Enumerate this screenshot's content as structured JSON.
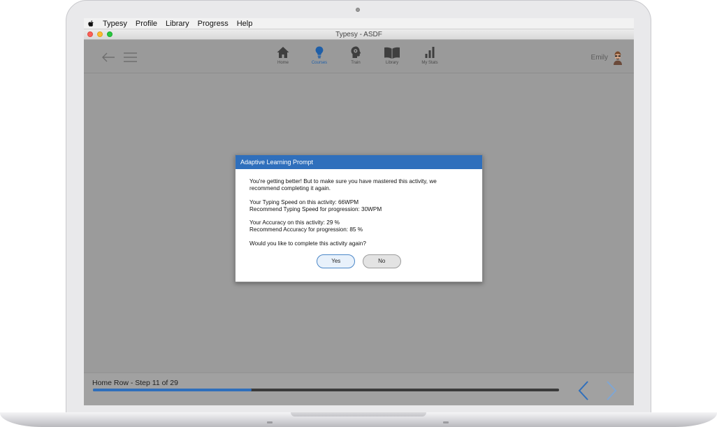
{
  "menubar": {
    "items": [
      "Typesy",
      "Profile",
      "Library",
      "Progress",
      "Help"
    ]
  },
  "window": {
    "title": "Typesy - ASDF"
  },
  "nav": {
    "back_icon": "arrow-left-icon",
    "menu_icon": "hamburger-icon",
    "items": [
      {
        "label": "Home",
        "icon": "home-icon",
        "active": false
      },
      {
        "label": "Courses",
        "icon": "lightbulb-icon",
        "active": true
      },
      {
        "label": "Train",
        "icon": "brain-head-icon",
        "active": false
      },
      {
        "label": "Library",
        "icon": "book-icon",
        "active": false
      },
      {
        "label": "My Stats",
        "icon": "bar-chart-icon",
        "active": false
      }
    ]
  },
  "user": {
    "name": "Emily"
  },
  "dialog": {
    "title": "Adaptive Learning Prompt",
    "intro": "You're getting better! But to make sure you have mastered this activity, we recommend completing it again.",
    "speed_line": "Your Typing Speed on this activity: 66WPM",
    "speed_recommend": "Recommend Typing Speed for progression: 30WPM",
    "accuracy_line": "Your Accuracy on this activity: 29 %",
    "accuracy_recommend": "Recommend Accuracy for progression: 85 %",
    "question": "Would you like to complete this activity again?",
    "yes_label": "Yes",
    "no_label": "No"
  },
  "footer": {
    "step_label": "Home Row - Step 11 of 29",
    "progress_fraction": 0.34
  },
  "colors": {
    "accent": "#2f6fbc",
    "app_background": "#9b9b9b"
  }
}
